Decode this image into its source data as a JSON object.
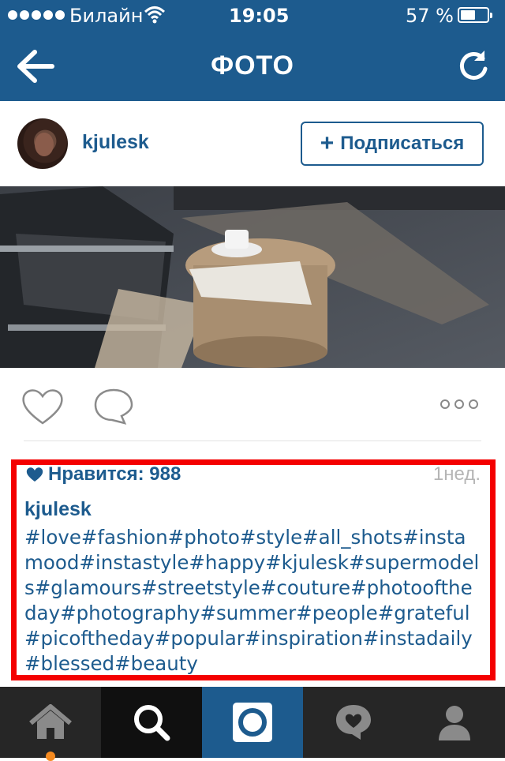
{
  "status_bar": {
    "carrier": "Билайн",
    "time": "19:05",
    "battery_percent": "57 %",
    "battery_level": 0.57
  },
  "navbar": {
    "title": "ФОТО",
    "back_icon": "arrow-left-icon",
    "refresh_icon": "refresh-icon"
  },
  "post": {
    "username": "kjulesk",
    "follow_label": "Подписаться",
    "likes_label": "Нравится: 988",
    "time_ago": "1нед.",
    "caption_user": "kjulesk",
    "caption": "#love#fashion#photo#style#all_shots#instamood#instastyle#happy#kjulesk#supermodels#glamours#streetstyle#couture#photooftheday#photography#summer#people#grateful#picoftheday#popular#inspiration#instadaily#blessed#beauty"
  },
  "tabbar": {
    "tabs": [
      {
        "name": "home",
        "icon": "home-icon",
        "active": true
      },
      {
        "name": "search",
        "icon": "search-icon"
      },
      {
        "name": "camera",
        "icon": "camera-icon"
      },
      {
        "name": "activity",
        "icon": "heart-bubble-icon"
      },
      {
        "name": "profile",
        "icon": "profile-icon"
      }
    ]
  },
  "colors": {
    "brand": "#1d5b8e",
    "highlight": "#f40000",
    "tab_indicator": "#f58a1f"
  }
}
